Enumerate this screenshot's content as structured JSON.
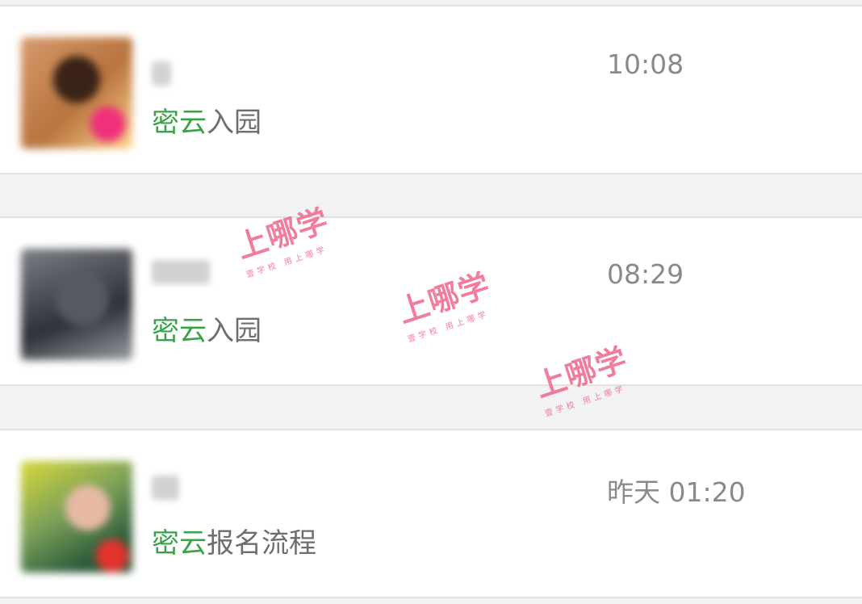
{
  "conversations": [
    {
      "time": "10:08",
      "msg_highlight": "密云",
      "msg_rest": "入园"
    },
    {
      "time": "08:29",
      "msg_highlight": "密云",
      "msg_rest": "入园"
    },
    {
      "time": "昨天 01:20",
      "msg_highlight": "密云",
      "msg_rest": "报名流程"
    }
  ],
  "watermark": {
    "title": "上哪学",
    "subtitle": "壹学校 用上哪学"
  },
  "colors": {
    "highlight": "#3aa34a",
    "time": "#8a8a8e",
    "watermark": "#f06f92"
  }
}
